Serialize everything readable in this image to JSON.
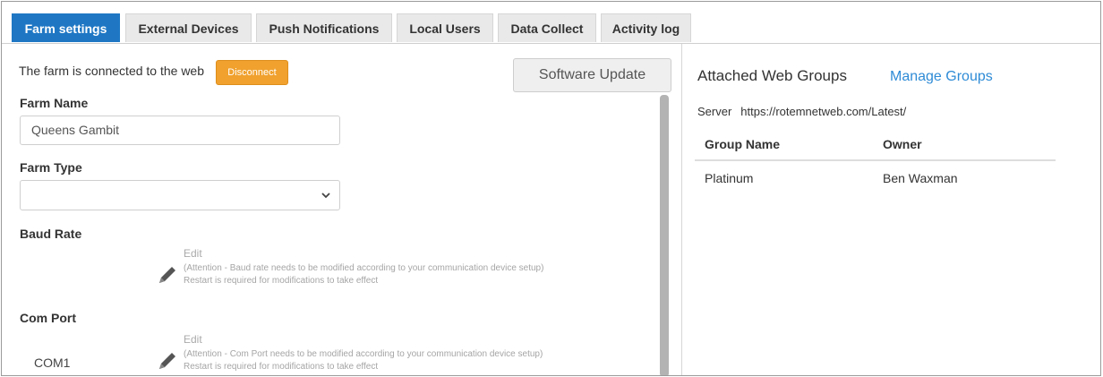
{
  "tabs": [
    {
      "label": "Farm settings",
      "active": true
    },
    {
      "label": "External Devices",
      "active": false
    },
    {
      "label": "Push Notifications",
      "active": false
    },
    {
      "label": "Local Users",
      "active": false
    },
    {
      "label": "Data Collect",
      "active": false
    },
    {
      "label": "Activity log",
      "active": false
    }
  ],
  "connection": {
    "status_text": "The farm is connected to the web",
    "disconnect_label": "Disconnect"
  },
  "software_update_label": "Software Update",
  "farm_name": {
    "label": "Farm Name",
    "value": "Queens Gambit"
  },
  "farm_type": {
    "label": "Farm Type",
    "selected": ""
  },
  "baud_rate": {
    "label": "Baud Rate",
    "edit_label": "Edit",
    "attention": "(Attention - Baud rate needs to be modified according to your communication device setup)",
    "restart": "Restart is required for modifications to take effect"
  },
  "com_port": {
    "label": "Com Port",
    "value": "COM1",
    "edit_label": "Edit",
    "attention": "(Attention - Com Port needs to be modified according to your communication device setup)",
    "restart": "Restart is required for modifications to take effect"
  },
  "web_groups": {
    "title": "Attached Web Groups",
    "manage_label": "Manage Groups",
    "server_label": "Server",
    "server_url": "https://rotemnetweb.com/Latest/",
    "columns": [
      "Group Name",
      "Owner"
    ],
    "rows": [
      {
        "group": "Platinum",
        "owner": "Ben Waxman"
      }
    ]
  },
  "colors": {
    "active_tab": "#1f77c4",
    "disconnect": "#f0a12e",
    "link": "#2e8bd6"
  }
}
